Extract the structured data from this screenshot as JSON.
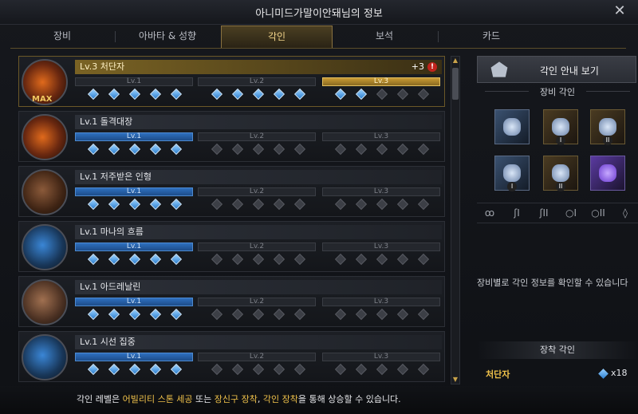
{
  "window": {
    "title": "아니미드가말이안돼님의 정보"
  },
  "tabs": [
    {
      "label": "장비"
    },
    {
      "label": "아바타 & 성향"
    },
    {
      "label": "각인"
    },
    {
      "label": "보석"
    },
    {
      "label": "카드"
    }
  ],
  "active_tab": "각인",
  "engravings": [
    {
      "name": "Lv.3 처단자",
      "badge": "MAX",
      "bonus": "+3",
      "alert": "!",
      "segments": [
        "Lv.1",
        "Lv.2",
        "Lv.3"
      ],
      "level": 3,
      "gems_filled": 12
    },
    {
      "name": "Lv.1 돌격대장",
      "segments": [
        "Lv.1",
        "Lv.2",
        "Lv.3"
      ],
      "level": 1,
      "gems_filled": 5
    },
    {
      "name": "Lv.1 저주받은 인형",
      "segments": [
        "Lv.1",
        "Lv.2",
        "Lv.3"
      ],
      "level": 1,
      "gems_filled": 5
    },
    {
      "name": "Lv.1 마나의 흐름",
      "segments": [
        "Lv.1",
        "Lv.2",
        "Lv.3"
      ],
      "level": 1,
      "gems_filled": 5
    },
    {
      "name": "Lv.1 아드레날린",
      "segments": [
        "Lv.1",
        "Lv.2",
        "Lv.3"
      ],
      "level": 1,
      "gems_filled": 5
    },
    {
      "name": "Lv.1 시선 집중",
      "segments": [
        "Lv.1",
        "Lv.2",
        "Lv.3"
      ],
      "level": 1,
      "gems_filled": 5
    }
  ],
  "side": {
    "guide_label": "각인 안내 보기",
    "equip_section": "장비 각인",
    "slots": [
      {
        "icon": "necklace-icon",
        "num": ""
      },
      {
        "icon": "earring-icon",
        "num": "I"
      },
      {
        "icon": "earring-icon",
        "num": "II"
      },
      {
        "icon": "ring-icon",
        "num": "I"
      },
      {
        "icon": "ring-icon",
        "num": "II"
      },
      {
        "icon": "stone-icon",
        "num": ""
      }
    ],
    "filters": [
      "necklace",
      "earring I",
      "earring II",
      "ring I",
      "ring II",
      "stone"
    ],
    "info_text": "장비별로 각인 정보를 확인할 수 있습니다",
    "mounted_section": "장착 각인",
    "mounted": {
      "name": "처단자",
      "count": "x18"
    }
  },
  "footer": {
    "prefix": "각인 레벨은 ",
    "hl1": "어빌리티 스톤 세공",
    "mid1": " 또는 ",
    "hl2": "장신구 장착",
    "mid2": ", ",
    "hl3": "각인 장착",
    "suffix": "을 통해 상승할 수 있습니다."
  }
}
